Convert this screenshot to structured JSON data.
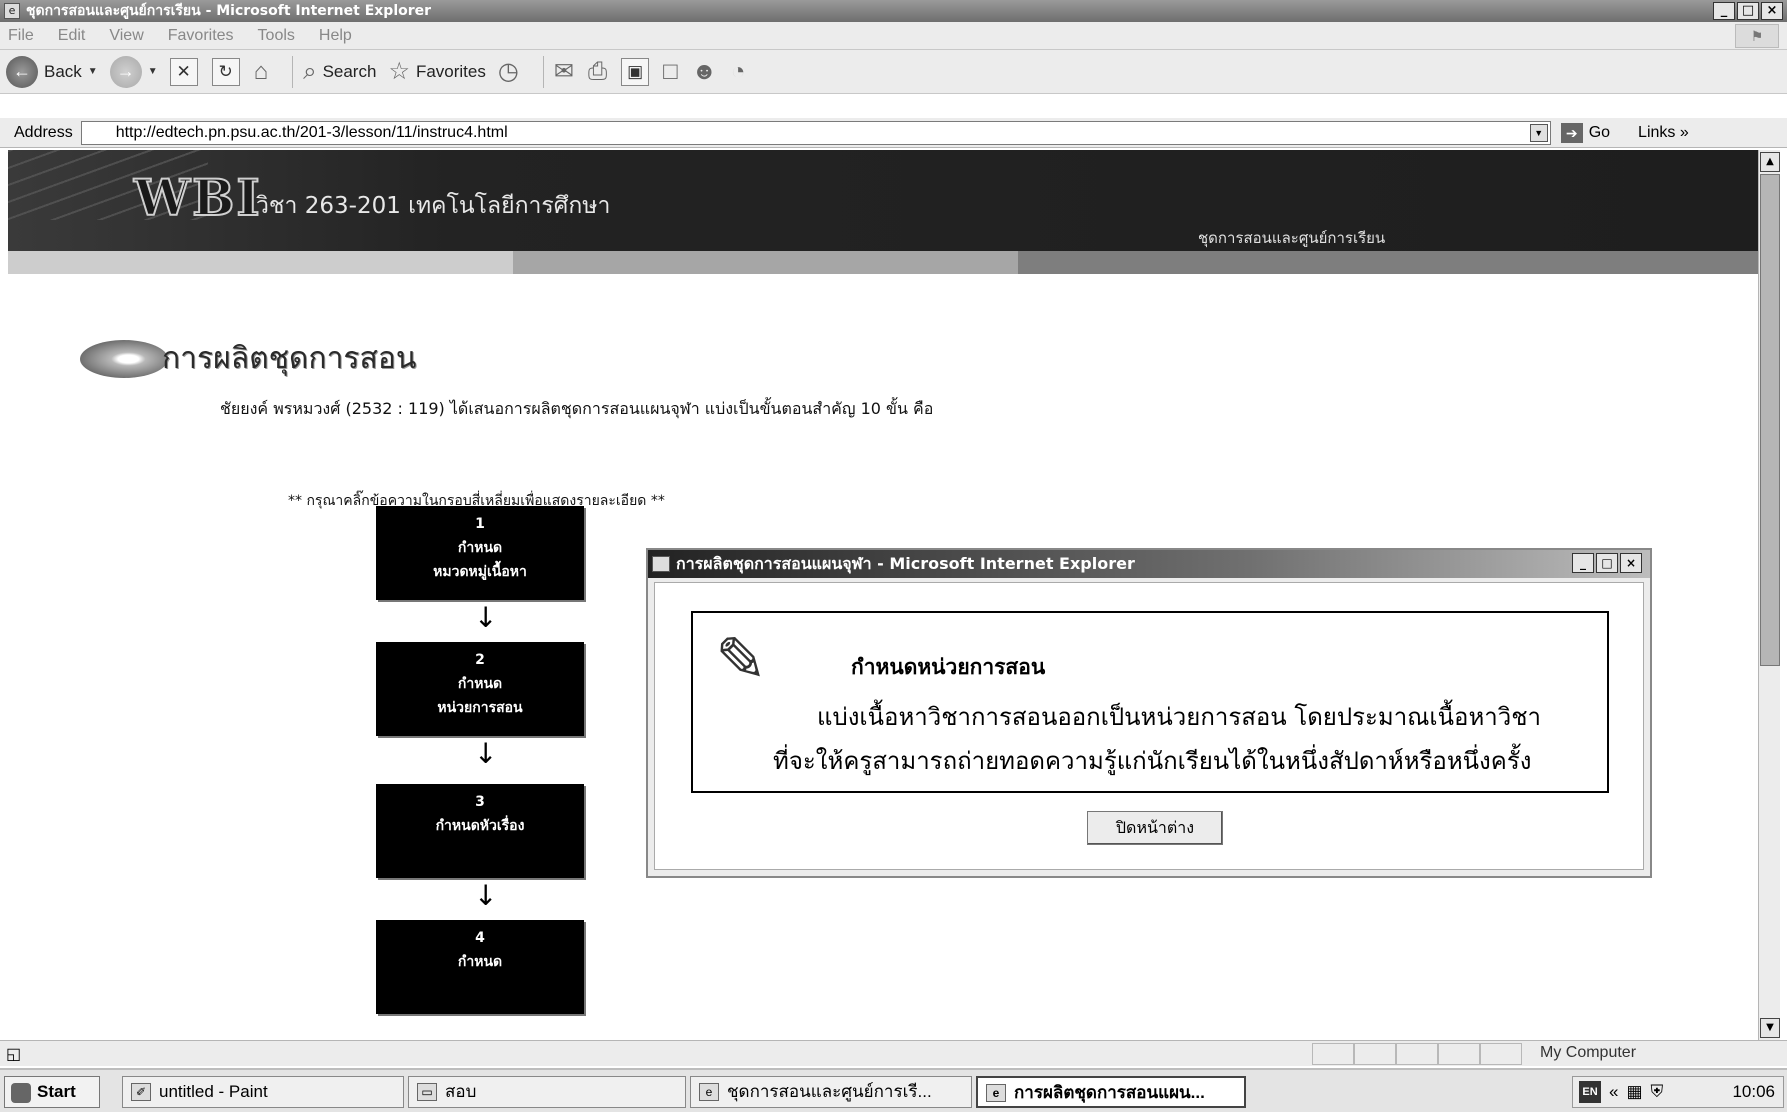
{
  "window": {
    "title": "ชุดการสอนและศูนย์การเรียน - Microsoft Internet Explorer",
    "controls": [
      "_",
      "□",
      "×"
    ]
  },
  "menu": [
    "File",
    "Edit",
    "View",
    "Favorites",
    "Tools",
    "Help"
  ],
  "toolbar": {
    "back_label": "Back",
    "search_label": "Search",
    "favorites_label": "Favorites"
  },
  "address": {
    "label": "Address",
    "url": "http://edtech.pn.psu.ac.th/201-3/lesson/11/instruc4.html",
    "go_label": "Go",
    "links_label": "Links »"
  },
  "page": {
    "logo": "WBI",
    "course": "วิชา 263-201 เทคโนโลยีการศึกษา",
    "topic": "ชุดการสอนและศูนย์การเรียน",
    "heading": "การผลิตชุดการสอน",
    "intro": "ชัยยงค์ พรหมวงศ์ (2532 : 119) ได้เสนอการผลิตชุดการสอนแผนจุฬา แบ่งเป็นขั้นตอนสำคัญ 10 ขั้น คือ",
    "hint": "** กรุณาคลิ๊กข้อความในกรอบสี่เหลี่ยมเพื่อแสดงรายละเอียด **",
    "steps": [
      {
        "num": "1",
        "line1": "กำหนด",
        "line2": "หมวดหมู่เนื้อหา"
      },
      {
        "num": "2",
        "line1": "กำหนด",
        "line2": "หน่วยการสอน"
      },
      {
        "num": "3",
        "line1": "กำหนดหัวเรื่อง",
        "line2": ""
      },
      {
        "num": "4",
        "line1": "กำหนด",
        "line2": ""
      }
    ]
  },
  "popup": {
    "title": "การผลิตชุดการสอนแผนจุฬา - Microsoft Internet Explorer",
    "box_title": "กำหนดหน่วยการสอน",
    "line1": "แบ่งเนื้อหาวิชาการสอนออกเป็นหน่วยการสอน โดยประมาณเนื้อหาวิชา",
    "line2": "ที่จะให้ครูสามารถถ่ายทอดความรู้แก่นักเรียนได้ในหนึ่งสัปดาห์หรือหนึ่งครั้ง",
    "close_label": "ปิดหน้าต่าง"
  },
  "status": {
    "zone": "My Computer"
  },
  "taskbar": {
    "start": "Start",
    "tasks": [
      "untitled - Paint",
      "สอบ",
      "ชุดการสอนและศูนย์การเรี...",
      "การผลิตชุดการสอนแผน..."
    ],
    "lang": "EN",
    "clock": "10:06"
  }
}
